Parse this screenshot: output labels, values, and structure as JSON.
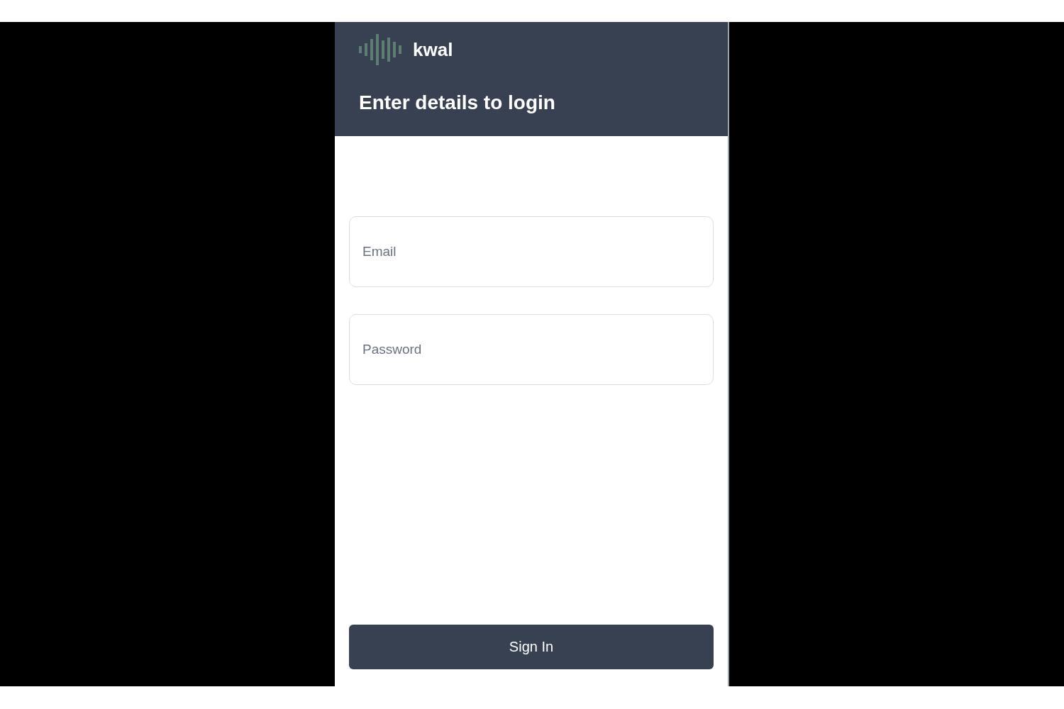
{
  "app": {
    "name": "kwal"
  },
  "heading": "Enter details to login",
  "fields": [
    {
      "placeholder": "Email"
    },
    {
      "placeholder": "Password"
    }
  ],
  "button": "Sign In"
}
